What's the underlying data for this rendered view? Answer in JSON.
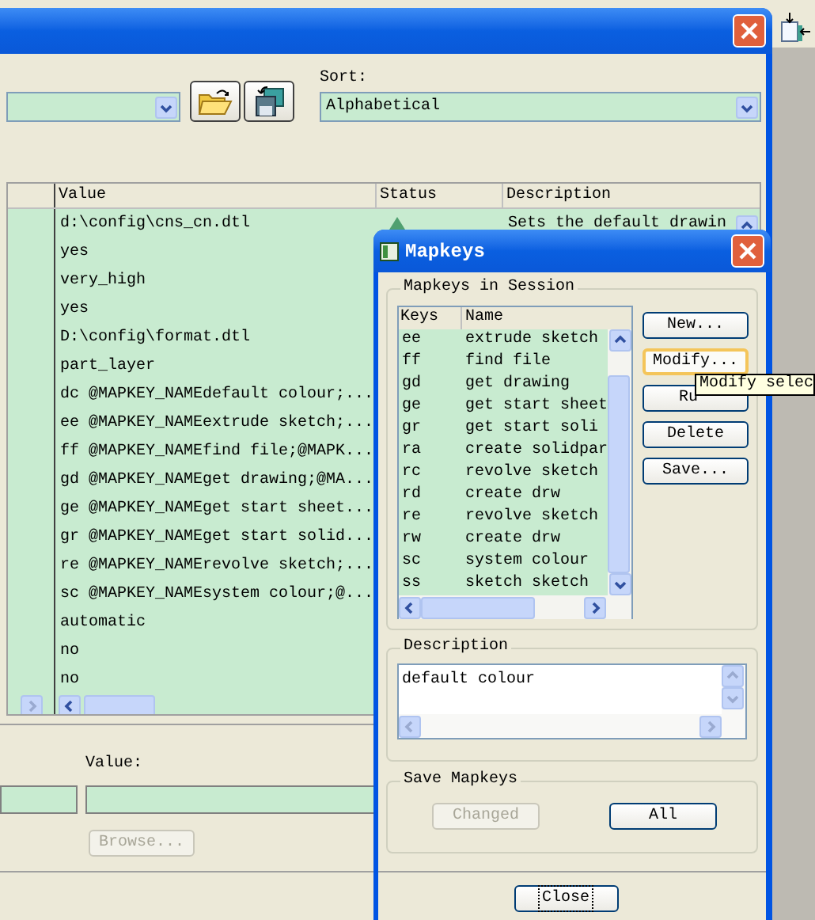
{
  "main_window": {
    "sort_label": "Sort:",
    "sort_value": "Alphabetical",
    "table": {
      "columns": [
        "Value",
        "Status",
        "Description"
      ],
      "rows": [
        {
          "kind": "described",
          "value": "d:\\config\\cns_cn.dtl",
          "description": "Sets the default drawin"
        },
        {
          "kind": "plain",
          "value": "yes"
        },
        {
          "kind": "plain",
          "value": "very_high"
        },
        {
          "kind": "plain",
          "value": "yes"
        },
        {
          "kind": "plain",
          "value": "D:\\config\\format.dtl"
        },
        {
          "kind": "plain",
          "value": "part_layer"
        },
        {
          "kind": "plain",
          "value": "dc @MAPKEY_NAMEdefault colour;..."
        },
        {
          "kind": "plain",
          "value": "ee @MAPKEY_NAMEextrude sketch;..."
        },
        {
          "kind": "plain",
          "value": "ff @MAPKEY_NAMEfind file;@MAPK..."
        },
        {
          "kind": "plain",
          "value": "gd @MAPKEY_NAMEget drawing;@MA..."
        },
        {
          "kind": "plain",
          "value": "ge @MAPKEY_NAMEget start sheet..."
        },
        {
          "kind": "plain",
          "value": "gr @MAPKEY_NAMEget start solid..."
        },
        {
          "kind": "plain",
          "value": "re @MAPKEY_NAMErevolve sketch;..."
        },
        {
          "kind": "plain",
          "value": "sc @MAPKEY_NAMEsystem colour;@..."
        },
        {
          "kind": "plain",
          "value": "automatic"
        },
        {
          "kind": "plain",
          "value": "no"
        },
        {
          "kind": "plain",
          "value": "no"
        }
      ]
    },
    "value_label": "Value:",
    "browse_button": {
      "label": "Browse...",
      "disabled": true
    }
  },
  "mapkeys_dialog": {
    "title": "Mapkeys",
    "session_group": "Mapkeys in Session",
    "list_columns": [
      "Keys",
      "Name"
    ],
    "mapkeys": [
      {
        "key": "ee",
        "name": "extrude sketch"
      },
      {
        "key": "ff",
        "name": "find file"
      },
      {
        "key": "gd",
        "name": "get drawing"
      },
      {
        "key": "ge",
        "name": "get start sheet"
      },
      {
        "key": "gr",
        "name": "get start soli"
      },
      {
        "key": "ra",
        "name": "create solidpar"
      },
      {
        "key": "rc",
        "name": "revolve sketch"
      },
      {
        "key": "rd",
        "name": "create drw"
      },
      {
        "key": "re",
        "name": "revolve sketch"
      },
      {
        "key": "rw",
        "name": "create drw"
      },
      {
        "key": "sc",
        "name": "system colour"
      },
      {
        "key": "ss",
        "name": "sketch sketch"
      }
    ],
    "buttons": [
      {
        "label": "New...",
        "hovered": false
      },
      {
        "label": "Modify...",
        "hovered": true
      },
      {
        "label": "Ru",
        "hovered": false
      },
      {
        "label": "Delete",
        "hovered": false
      },
      {
        "label": "Save...",
        "hovered": false
      }
    ],
    "tooltip": "Modify selec",
    "description_group": "Description",
    "description_text": "default colour",
    "save_group": "Save Mapkeys",
    "save_buttons": [
      {
        "label": "Changed",
        "disabled": true
      },
      {
        "label": "All",
        "disabled": false
      }
    ],
    "close_button": "Close"
  }
}
